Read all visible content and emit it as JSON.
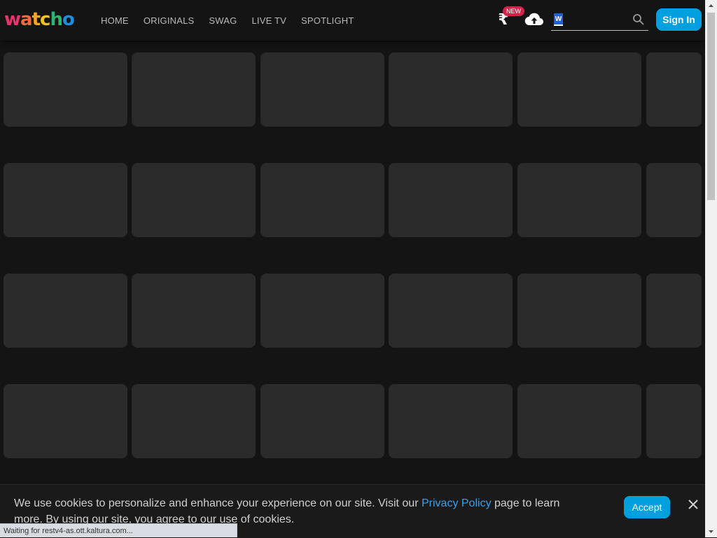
{
  "brand": {
    "logo_letters": [
      "w",
      "a",
      "t",
      "c",
      "h",
      "o"
    ],
    "logo_colors": [
      "#e8336b",
      "#f26a3b",
      "#f5a623",
      "#f0c419",
      "#2bb673",
      "#1c8fe0"
    ]
  },
  "nav": {
    "items": [
      "HOME",
      "ORIGINALS",
      "SWAG",
      "LIVE TV",
      "SPOTLIGHT"
    ]
  },
  "header": {
    "rupee_symbol": "₹",
    "new_badge": "NEW",
    "upload_icon": "cloud-upload-icon",
    "search_badge": "W",
    "search_placeholder": "",
    "signin_label": "Sign In",
    "accent_color": "#00a0df"
  },
  "grid": {
    "rows": 4,
    "columns_full": 5,
    "columns_partial": 1,
    "tile_color": "#2b2b2b"
  },
  "cookie": {
    "text_before": "We use cookies to personalize and enhance your experience on our site. Visit our ",
    "link": "Privacy Policy",
    "text_after": " page to learn more. By using our site, you agree to our use of cookies.",
    "accept_label": "Accept",
    "close_icon": "close-icon"
  },
  "status": {
    "text": "Waiting for restv4-as.ott.kaltura.com..."
  }
}
